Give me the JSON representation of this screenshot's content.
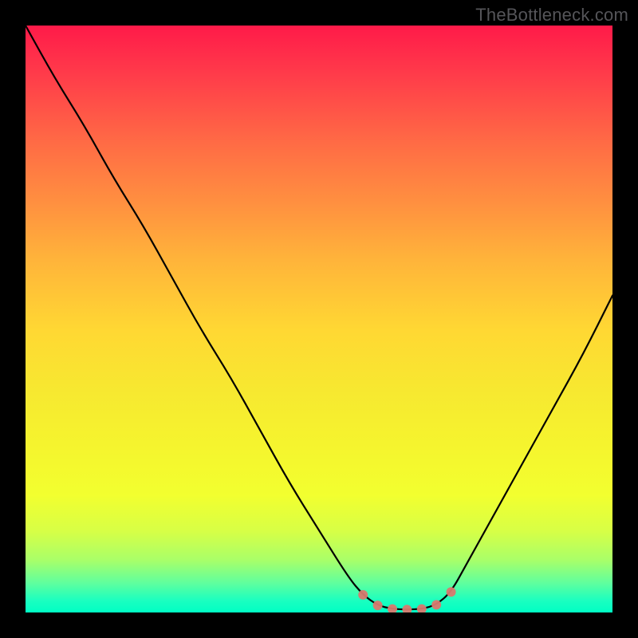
{
  "watermark": "TheBottleneck.com",
  "colors": {
    "curve": "#000000",
    "marker": "#d97a6f",
    "gradient_top": "#ff1a49",
    "gradient_bottom": "#00ffc4"
  },
  "chart_data": {
    "type": "line",
    "title": "",
    "xlabel": "",
    "ylabel": "",
    "xlim": [
      0,
      100
    ],
    "ylim": [
      0,
      100
    ],
    "x": [
      0,
      5,
      10,
      15,
      20,
      25,
      30,
      35,
      40,
      45,
      50,
      55,
      57.5,
      60,
      62.5,
      65,
      67.5,
      70,
      72.5,
      75,
      80,
      85,
      90,
      95,
      100
    ],
    "y": [
      100,
      91,
      83,
      74,
      66,
      57,
      48,
      40,
      31,
      22,
      14,
      6,
      3,
      1.2,
      0.6,
      0.5,
      0.6,
      1.3,
      3.5,
      8,
      17,
      26,
      35,
      44,
      54
    ],
    "markers": {
      "x": [
        57.5,
        60,
        62.5,
        65,
        67.5,
        70,
        72.5
      ],
      "y": [
        3,
        1.2,
        0.6,
        0.5,
        0.6,
        1.3,
        3.5
      ],
      "color": "#d97a6f"
    },
    "annotations": []
  }
}
